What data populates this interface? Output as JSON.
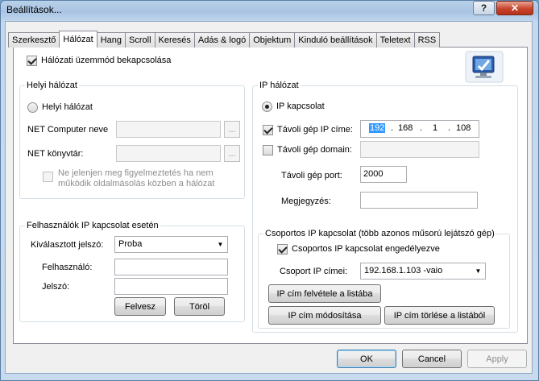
{
  "window": {
    "title": "Beállítások..."
  },
  "titlebar": {
    "help_label": "?",
    "close_label": "✕"
  },
  "tabs": [
    {
      "label": "Szerkesztő"
    },
    {
      "label": "Hálózat"
    },
    {
      "label": "Hang"
    },
    {
      "label": "Scroll"
    },
    {
      "label": "Keresés"
    },
    {
      "label": "Adás & logó"
    },
    {
      "label": "Objektum"
    },
    {
      "label": "Kinduló beállítások"
    },
    {
      "label": "Teletext"
    },
    {
      "label": "RSS"
    }
  ],
  "network_mode": {
    "label": "Hálózati üzemmód bekapcsolása",
    "checked": true,
    "icon": "network-computer-icon"
  },
  "local": {
    "title": "Helyi hálózat",
    "radio_label": "Helyi hálózat",
    "computer_name_label": "NET Computer neve",
    "computer_name_value": "",
    "directory_label": "NET könyvtár:",
    "directory_value": "",
    "browse_label": "...",
    "warning_label_1": "Ne jelenjen meg figyelmeztetés ha nem",
    "warning_label_2": "működik oldalmásolás közben a hálózat"
  },
  "users": {
    "title": "Felhasználók IP kapcsolat esetén",
    "selected_password_label": "Kiválasztott jelszó:",
    "selected_password_value": "Proba",
    "user_label": "Felhasználó:",
    "user_value": "",
    "password_label": "Jelszó:",
    "password_value": "",
    "add_label": "Felvesz",
    "delete_label": "Töröl"
  },
  "ip": {
    "title": "IP hálózat",
    "radio_label": "IP kapcsolat",
    "remote_ip_label": "Távoli gép IP címe:",
    "remote_ip_checked": true,
    "ip_octets": [
      "192",
      "168",
      "1",
      "108"
    ],
    "ip_dot": ".",
    "remote_domain_label": "Távoli gép domain:",
    "remote_domain_checked": false,
    "remote_domain_value": "",
    "remote_port_label": "Távoli gép port:",
    "remote_port_value": "2000",
    "note_label": "Megjegyzés:",
    "note_value": ""
  },
  "group_ip": {
    "title": "Csoportos IP kapcsolat (több azonos műsorú lejátszó gép)",
    "enable_label": "Csoportos IP kapcsolat engedélyezve",
    "enable_checked": true,
    "addresses_label": "Csoport IP címei:",
    "addresses_value": "192.168.1.103 -vaio",
    "add_label": "IP cím felvétele a listába",
    "modify_label": "IP cím módosítása",
    "delete_label": "IP cím törlése a listából"
  },
  "footer": {
    "ok_label": "OK",
    "cancel_label": "Cancel",
    "apply_label": "Apply"
  }
}
